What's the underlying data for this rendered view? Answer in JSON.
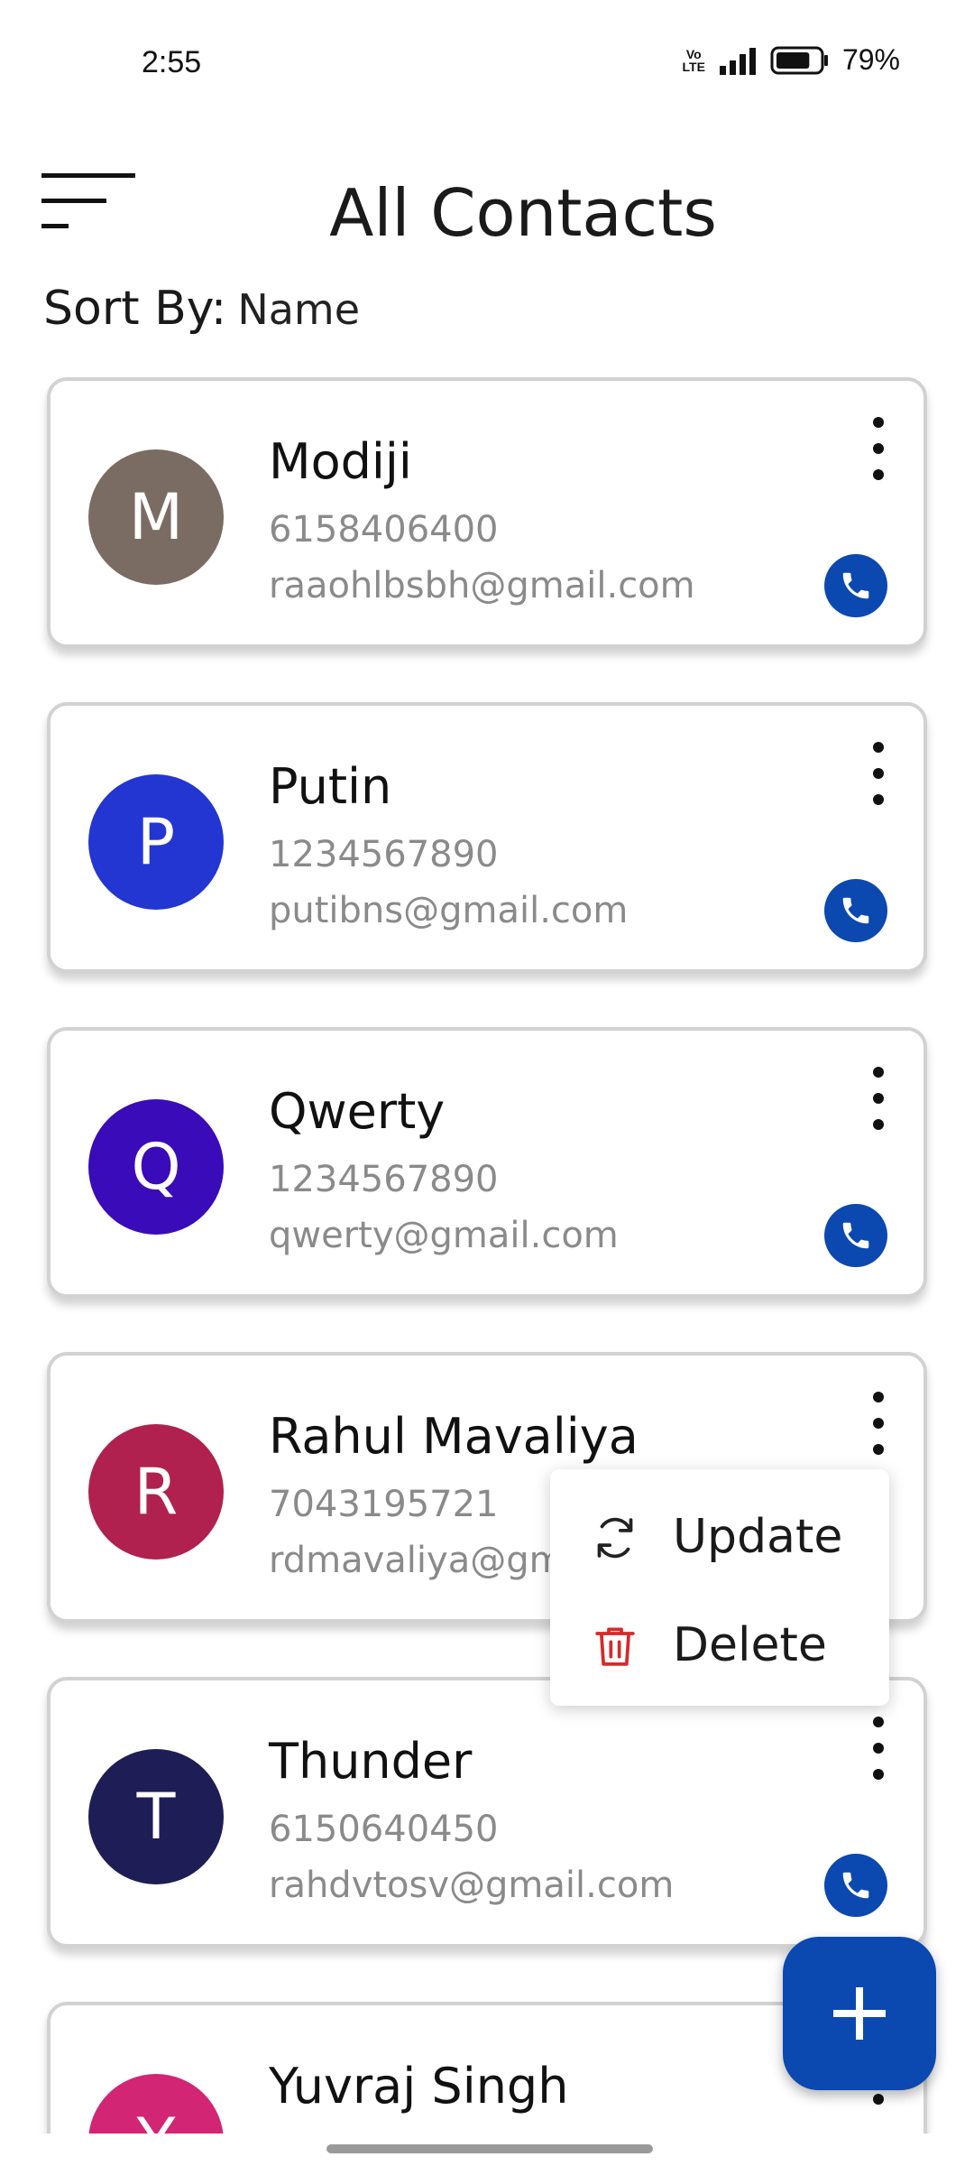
{
  "status_bar": {
    "time": "2:55",
    "volte_top": "Vo",
    "volte_bottom": "LTE",
    "battery_percent": "79%",
    "battery_level": 0.79
  },
  "header": {
    "title": "All Contacts",
    "menu_icon": "sort-lines-icon"
  },
  "sort": {
    "label": "Sort By:",
    "value": "Name"
  },
  "contacts": [
    {
      "initial": "M",
      "name": "Modiji",
      "phone": "6158406400",
      "email": "raaohlbsbh@gmail.com",
      "avatar_color": "#7a6c62"
    },
    {
      "initial": "P",
      "name": "Putin",
      "phone": "1234567890",
      "email": "putibns@gmail.com",
      "avatar_color": "#2336d1"
    },
    {
      "initial": "Q",
      "name": "Qwerty",
      "phone": "1234567890",
      "email": "qwerty@gmail.com",
      "avatar_color": "#3a0bb8"
    },
    {
      "initial": "R",
      "name": "Rahul Mavaliya",
      "phone": "7043195721",
      "email": "rdmavaliya@gmail.com",
      "avatar_color": "#b0214f"
    },
    {
      "initial": "T",
      "name": "Thunder",
      "phone": "6150640450",
      "email": "rahdvtosv@gmail.com",
      "avatar_color": "#1f1d55"
    },
    {
      "initial": "Y",
      "name": "Yuvraj Singh",
      "phone": "",
      "email": "",
      "avatar_color": "#d22574"
    }
  ],
  "context_menu": {
    "update_label": "Update",
    "delete_label": "Delete",
    "update_icon": "refresh-icon",
    "delete_icon": "trash-icon"
  },
  "fab": {
    "icon": "plus-icon"
  },
  "colors": {
    "accent": "#0b48b0",
    "delete_red": "#d42a2a"
  }
}
